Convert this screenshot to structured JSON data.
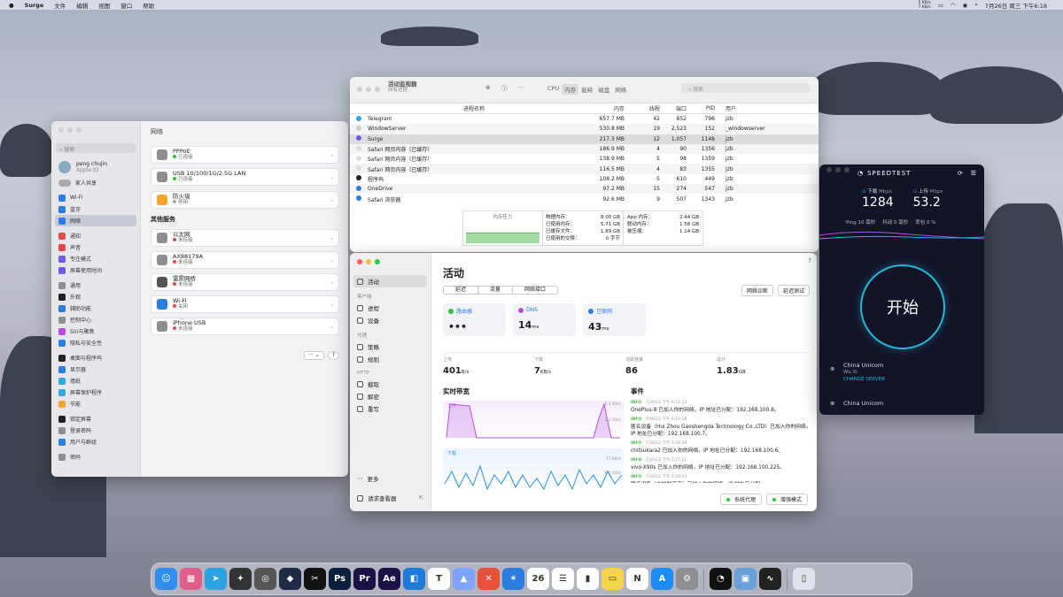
{
  "menubar": {
    "app": "Surge",
    "items": [
      "文件",
      "编辑",
      "视图",
      "窗口",
      "帮助"
    ],
    "net_up": "5 KB/s",
    "net_down": "7 KB/s",
    "datetime": "7月26日 周三 下午6:18"
  },
  "settings": {
    "search": "搜索",
    "user_name": "peng chujin",
    "user_sub": "Apple ID",
    "family": "家人共享",
    "sidebar": [
      {
        "label": "Wi-Fi",
        "color": "#2b7de0"
      },
      {
        "label": "蓝牙",
        "color": "#2b7de0"
      },
      {
        "label": "网络",
        "color": "#2b7de0",
        "selected": true
      },
      {
        "label": "通知",
        "color": "#e5484d",
        "gap": true
      },
      {
        "label": "声音",
        "color": "#e5484d"
      },
      {
        "label": "专注模式",
        "color": "#6c5ce7"
      },
      {
        "label": "屏幕使用时间",
        "color": "#6c5ce7"
      },
      {
        "label": "通用",
        "color": "#8e8e93",
        "gap": true
      },
      {
        "label": "外观",
        "color": "#222"
      },
      {
        "label": "辅助功能",
        "color": "#2b7de0"
      },
      {
        "label": "控制中心",
        "color": "#8e8e93"
      },
      {
        "label": "Siri与聚焦",
        "color": "#b450e0"
      },
      {
        "label": "隐私与安全性",
        "color": "#2b7de0"
      },
      {
        "label": "桌面与程序坞",
        "color": "#222",
        "gap": true
      },
      {
        "label": "显示器",
        "color": "#2b7de0"
      },
      {
        "label": "墙纸",
        "color": "#35a8d8"
      },
      {
        "label": "屏幕保护程序",
        "color": "#35a8d8"
      },
      {
        "label": "节能",
        "color": "#f2a62c"
      },
      {
        "label": "锁定屏幕",
        "color": "#222",
        "gap": true
      },
      {
        "label": "登录密码",
        "color": "#8e8e93"
      },
      {
        "label": "用户与群组",
        "color": "#2b7de0"
      },
      {
        "label": "密码",
        "color": "#8e8e93",
        "gap": true
      }
    ],
    "title": "网络",
    "cards": [
      {
        "name": "PPPoE",
        "status": "已连接",
        "dot": "#28c840",
        "color": "#8d8d92"
      },
      {
        "name": "USB 10/100/1G/2.5G LAN",
        "status": "已连接",
        "dot": "#28c840",
        "color": "#8d8d92"
      }
    ],
    "firewall": {
      "name": "防火墙",
      "status": "停用",
      "color": "#f2a62c"
    },
    "other_title": "其他服务",
    "other": [
      {
        "name": "以太网",
        "status": "未连接",
        "dot": "#e5484d",
        "color": "#8d8d92"
      },
      {
        "name": "AX88179A",
        "status": "未连接",
        "dot": "#e5484d",
        "color": "#8d8d92"
      },
      {
        "name": "雷雳网桥",
        "status": "未连接",
        "dot": "#e5484d",
        "color": "#555"
      },
      {
        "name": "Wi-Fi",
        "status": "关闭",
        "dot": "#e5484d",
        "color": "#2b7de0"
      },
      {
        "name": "iPhone USB",
        "status": "未连接",
        "dot": "#e5484d",
        "color": "#8d8d92"
      }
    ],
    "more_btn": "··· ⌄",
    "help_btn": "?"
  },
  "actmon": {
    "title": "活动监视器",
    "subtitle": "所有进程",
    "tabs": [
      "CPU",
      "内存",
      "能耗",
      "磁盘",
      "网络"
    ],
    "search": "搜索",
    "cols": [
      "进程名称",
      "内存",
      "线程",
      "端口",
      "PID",
      "用户"
    ],
    "rows": [
      [
        "Telegram",
        "657.7 MB",
        "42",
        "852",
        "796",
        "jzb"
      ],
      [
        "WindowServer",
        "530.8 MB",
        "19",
        "2,523",
        "152",
        "_windowserver"
      ],
      [
        "Surge",
        "217.3 MB",
        "12",
        "1,057",
        "1148",
        "jzb"
      ],
      [
        "Safari 网页内容（已缓存）",
        "186.9 MB",
        "4",
        "90",
        "1356",
        "jzb"
      ],
      [
        "Safari 网页内容（已缓存）",
        "138.9 MB",
        "5",
        "98",
        "1359",
        "jzb"
      ],
      [
        "Safari 网页内容（已缓存）",
        "116.5 MB",
        "4",
        "83",
        "1355",
        "jzb"
      ],
      [
        "程序坞",
        "108.2 MB",
        "5",
        "610",
        "449",
        "jzb"
      ],
      [
        "OneDrive",
        "97.2 MB",
        "15",
        "274",
        "547",
        "jzb"
      ],
      [
        "Safari 浏览器",
        "92.6 MB",
        "9",
        "507",
        "1343",
        "jzb"
      ]
    ],
    "pressure": "内存压力",
    "mem": [
      [
        "物理内存：",
        "8.00 GB"
      ],
      [
        "已使用内存：",
        "5.71 GB"
      ],
      [
        "已缓存文件：",
        "1.89 GB"
      ],
      [
        "已使用的交换：",
        "0 字节"
      ]
    ],
    "mem2": [
      [
        "App 内存：",
        "2.44 GB"
      ],
      [
        "联动内存：",
        "1.58 GB"
      ],
      [
        "被压缩：",
        "1.14 GB"
      ]
    ]
  },
  "surge": {
    "nav": [
      {
        "label": "活动",
        "selected": true
      },
      {
        "head": "客户端"
      },
      {
        "label": "进程"
      },
      {
        "label": "设备"
      },
      {
        "head": "代理"
      },
      {
        "label": "策略"
      },
      {
        "label": "规则"
      },
      {
        "head": "HTTP"
      },
      {
        "label": "截取"
      },
      {
        "label": "解密"
      },
      {
        "label": "重写"
      }
    ],
    "more": "更多",
    "viewer": "请求查看器",
    "title": "活动",
    "seg": [
      "延迟",
      "流量",
      "网络接口"
    ],
    "diag": "网络诊断",
    "latency_test": "延迟测试",
    "tiles": [
      {
        "label": "路由器",
        "value": "•••",
        "unit": "",
        "color": "#28c840"
      },
      {
        "label": "DNS",
        "value": "14",
        "unit": "ms",
        "color": "#b450e0"
      },
      {
        "label": "互联网",
        "value": "43",
        "unit": "ms",
        "color": "#2b7de0"
      }
    ],
    "stats": [
      {
        "label": "上传",
        "value": "401",
        "unit": "B/s"
      },
      {
        "label": "下载",
        "value": "7",
        "unit": "KB/s"
      },
      {
        "label": "活跃连接",
        "value": "86",
        "unit": ""
      },
      {
        "label": "总计",
        "value": "1.83",
        "unit": "GB"
      }
    ],
    "bw_title": "实时带宽",
    "events_title": "事件",
    "upload_label": "上传",
    "download_label": "下载",
    "up_scale": [
      "2.4 KB/s",
      "1.2 KB/s"
    ],
    "down_scale": [
      "17 KB/s",
      "8.6 KB/s"
    ],
    "events": [
      {
        "tag": "INFO",
        "time": "7/26/23 下午 6:11:13",
        "msg": "OnePlus-8 已加入你的网络，IP 地址已分配：192.168.100.8。"
      },
      {
        "tag": "INFO",
        "time": "7/26/23 下午 6:10:18",
        "msg": "匿名设备（Hui Zhou Gaoshengda Technology Co.,LTD）已加入你的网络，IP 地址已分配：192.168.100.7。"
      },
      {
        "tag": "INFO",
        "time": "7/26/23 下午 5:59:58",
        "msg": "chitsukara2 已加入你的网络，IP 地址已分配：192.168.100.6。"
      },
      {
        "tag": "INFO",
        "time": "7/26/23 下午 5:57:11",
        "msg": "vivo-X90s 已加入你的网络，IP 地址已分配：192.168.100.225。"
      },
      {
        "tag": "INFO",
        "time": "7/26/23 下午 5:56:03",
        "msg": "匿名设备（未知制造商）已加入你的网络，IP 地址已分配。"
      }
    ],
    "sys_proxy": "系统代理",
    "enhanced": "增强模式"
  },
  "speedtest": {
    "brand": "SPEEDTEST",
    "dl_label": "下载",
    "ul_label": "上传",
    "unit": "Mbps",
    "dl": "1284",
    "ul": "53.2",
    "ping": "Ping 10 毫秒",
    "jitter": "抖动 0 毫秒",
    "loss": "丢包 0 %",
    "go": "开始",
    "isp1": "China Unicom",
    "loc": "Wu Xi",
    "change": "CHANGE SERVER",
    "isp2": "China Unicom"
  },
  "dock": [
    {
      "name": "finder",
      "glyph": "☺",
      "bg": "#2f8ef0"
    },
    {
      "name": "launchpad",
      "glyph": "▦",
      "bg": "#e05e8c"
    },
    {
      "name": "telegram",
      "glyph": "➤",
      "bg": "#2aa3e0"
    },
    {
      "name": "final-cut",
      "glyph": "✦",
      "bg": "#333"
    },
    {
      "name": "motion",
      "glyph": "◎",
      "bg": "#555"
    },
    {
      "name": "davinci",
      "glyph": "◆",
      "bg": "#1f2a44"
    },
    {
      "name": "capcut",
      "glyph": "✂",
      "bg": "#111"
    },
    {
      "name": "photoshop",
      "glyph": "Ps",
      "bg": "#0b1f3a"
    },
    {
      "name": "premiere",
      "glyph": "Pr",
      "bg": "#1c1145"
    },
    {
      "name": "after-effects",
      "glyph": "Ae",
      "bg": "#1c1145"
    },
    {
      "name": "app-blue",
      "glyph": "◧",
      "bg": "#1c7ad8"
    },
    {
      "name": "typora",
      "glyph": "T",
      "bg": "#fff"
    },
    {
      "name": "affinity",
      "glyph": "▲",
      "bg": "#7fa3ff"
    },
    {
      "name": "xmind",
      "glyph": "✕",
      "bg": "#e8503a"
    },
    {
      "name": "safari",
      "glyph": "✶",
      "bg": "#2b7de0"
    },
    {
      "name": "calendar",
      "glyph": "26",
      "bg": "#fff"
    },
    {
      "name": "reminders",
      "glyph": "☰",
      "bg": "#fff"
    },
    {
      "name": "stats",
      "glyph": "▮",
      "bg": "#fff"
    },
    {
      "name": "notes",
      "glyph": "▭",
      "bg": "#f5d34a"
    },
    {
      "name": "news",
      "glyph": "N",
      "bg": "#fff"
    },
    {
      "name": "app-store",
      "glyph": "A",
      "bg": "#1b8ef5"
    },
    {
      "name": "system-settings",
      "glyph": "⚙",
      "bg": "#8e8e93"
    },
    {
      "name": "speedtest",
      "glyph": "◔",
      "bg": "#111"
    },
    {
      "name": "preview",
      "glyph": "▣",
      "bg": "#6ba0d8"
    },
    {
      "name": "activity-monitor",
      "glyph": "∿",
      "bg": "#222"
    },
    {
      "name": "trash",
      "glyph": "▯",
      "bg": "#dfe2e8"
    }
  ]
}
